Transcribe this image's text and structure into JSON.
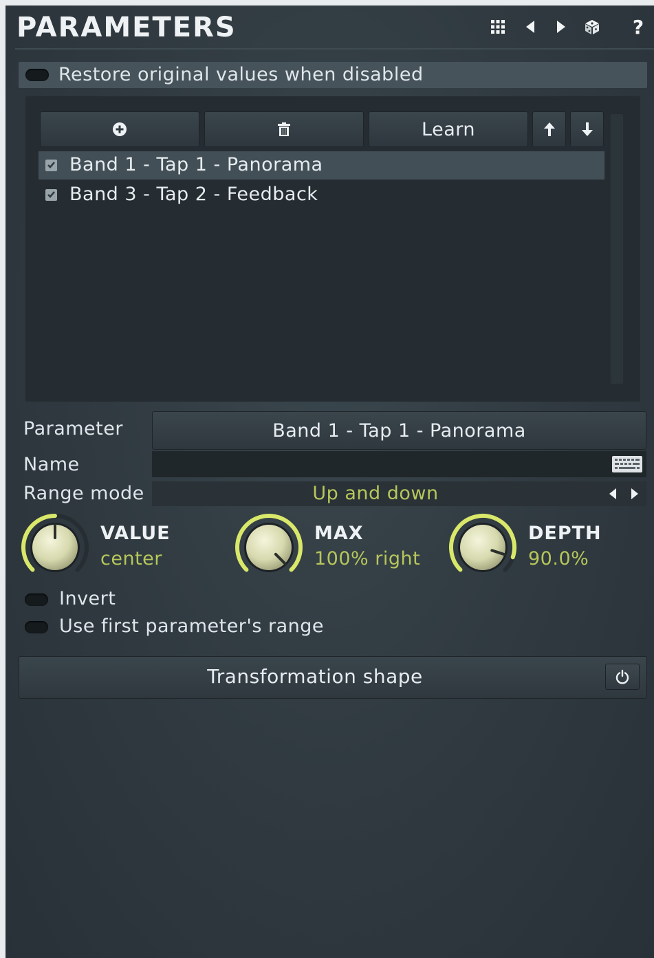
{
  "header": {
    "title": "PARAMETERS",
    "icons": [
      "grid-icon",
      "prev-arrow-icon",
      "next-arrow-icon",
      "random-dice-icon",
      "help-icon"
    ],
    "help_label": "?"
  },
  "restore_toggle": {
    "label": "Restore original values when disabled",
    "on": false
  },
  "list_toolbar": {
    "add_icon": "add-circle-icon",
    "delete_icon": "trash-icon",
    "learn_label": "Learn",
    "move_up_icon": "arrow-up-icon",
    "move_down_icon": "arrow-down-icon"
  },
  "parameters": [
    {
      "label": "Band 1 - Tap 1 - Panorama",
      "checked": true,
      "selected": true
    },
    {
      "label": "Band 3 - Tap 2 - Feedback",
      "checked": true,
      "selected": false
    }
  ],
  "fields": {
    "parameter_label": "Parameter",
    "parameter_value": "Band 1 - Tap 1 - Panorama",
    "name_label": "Name",
    "name_value": "",
    "range_mode_label": "Range mode",
    "range_mode_value": "Up and down"
  },
  "knobs": {
    "value": {
      "title": "VALUE",
      "display": "center",
      "fraction": 0.5
    },
    "max": {
      "title": "MAX",
      "display": "100% right",
      "fraction": 1.0
    },
    "depth": {
      "title": "DEPTH",
      "display": "90.0%",
      "fraction": 0.9
    }
  },
  "options": {
    "invert_label": "Invert",
    "use_first_range_label": "Use first parameter's range"
  },
  "transformation": {
    "label": "Transformation shape",
    "power_icon": "power-icon"
  },
  "colors": {
    "accent": "#b7c65b",
    "knob_ring": "#d9e86a",
    "panel": "#2f393f"
  }
}
